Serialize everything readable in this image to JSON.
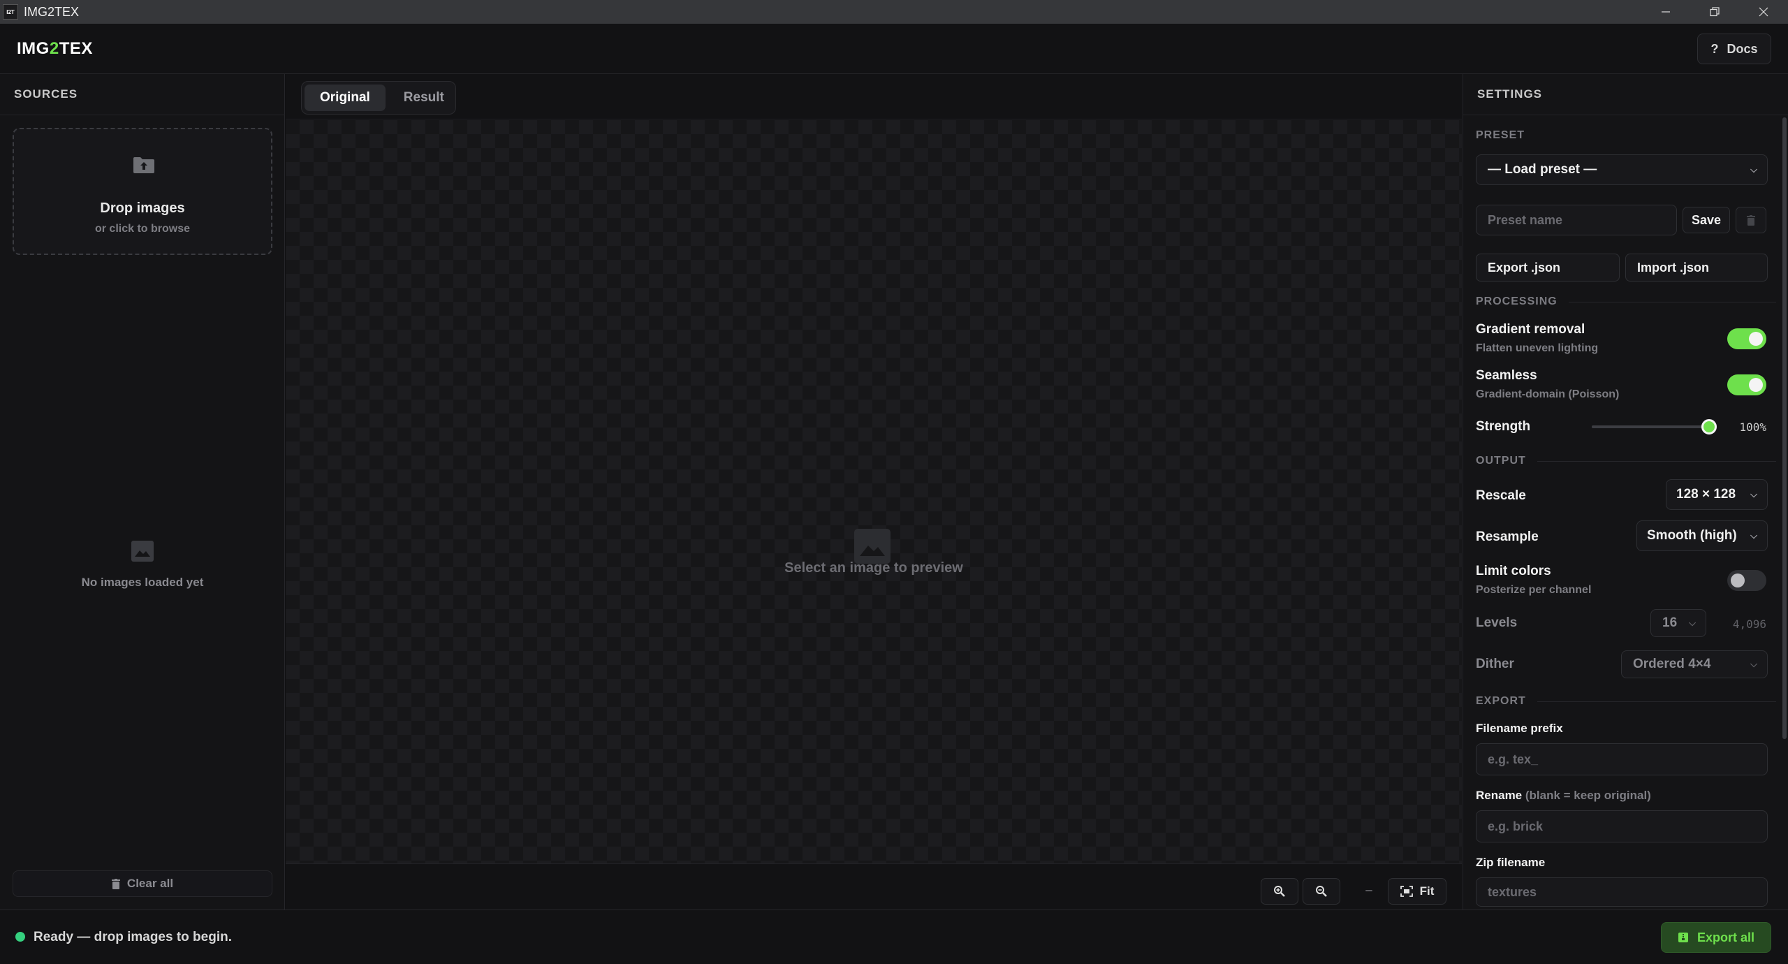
{
  "window": {
    "app_icon_text": "I2T",
    "title": "IMG2TEX",
    "controls": [
      "minimize",
      "restore",
      "close"
    ]
  },
  "header": {
    "logo_part1": "IMG",
    "logo_part2": "2",
    "logo_part3": "TEX",
    "docs_icon": "?",
    "docs_label": "Docs"
  },
  "sidebar": {
    "title": "SOURCES",
    "dropzone_title": "Drop images",
    "dropzone_subtitle": "or click to browse",
    "empty_text": "No images loaded yet",
    "clear_label": "Clear all"
  },
  "center": {
    "tabs": [
      {
        "label": "Original",
        "active": true
      },
      {
        "label": "Result",
        "active": false
      }
    ],
    "preview_placeholder": "Select an image to preview",
    "zoom_level": "–",
    "fit_label": "Fit"
  },
  "settings": {
    "title": "SETTINGS",
    "preset": {
      "section": "PRESET",
      "load_label": "— Load preset —",
      "name_placeholder": "Preset name",
      "save_label": "Save",
      "export_json_label": "Export .json",
      "import_json_label": "Import .json"
    },
    "processing": {
      "section": "PROCESSING",
      "gradient_label": "Gradient removal",
      "gradient_desc": "Flatten uneven lighting",
      "gradient_on": true,
      "seamless_label": "Seamless",
      "seamless_desc": "Gradient-domain (Poisson)",
      "seamless_on": true,
      "strength_label": "Strength",
      "strength_value": "100%",
      "strength_fraction": 1.0
    },
    "output": {
      "section": "OUTPUT",
      "rescale_label": "Rescale",
      "rescale_value": "128 × 128",
      "resample_label": "Resample",
      "resample_value": "Smooth (high)",
      "limit_label": "Limit colors",
      "limit_desc": "Posterize per channel",
      "limit_on": false,
      "levels_label": "Levels",
      "levels_value": "16",
      "levels_count": "4,096",
      "dither_label": "Dither",
      "dither_value": "Ordered 4×4"
    },
    "export": {
      "section": "EXPORT",
      "prefix_label": "Filename prefix",
      "prefix_placeholder": "e.g. tex_",
      "rename_label": "Rename",
      "rename_hint": "(blank = keep original)",
      "rename_placeholder": "e.g. brick",
      "zip_label": "Zip filename",
      "zip_placeholder": "textures"
    }
  },
  "footer": {
    "status_text": "Ready — drop images to begin.",
    "export_all_label": "Export all"
  },
  "colors": {
    "accent": "#6ee04c",
    "status_ok": "#35d07f",
    "background": "#121214"
  }
}
